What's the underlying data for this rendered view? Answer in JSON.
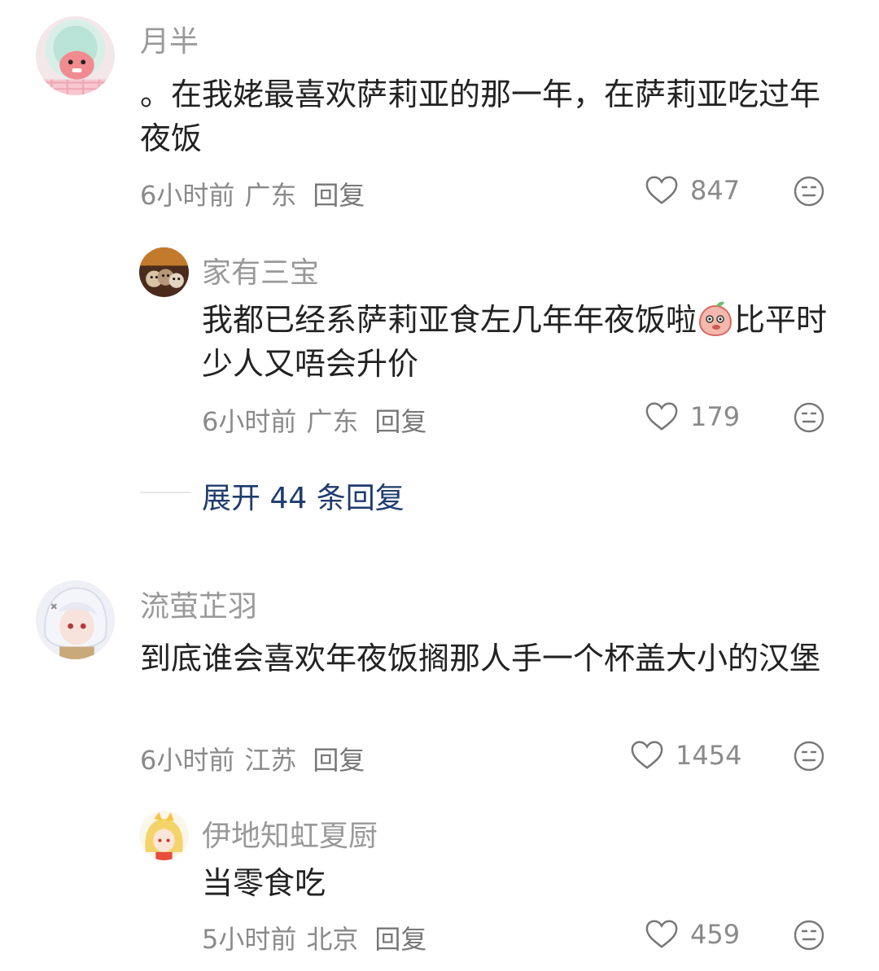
{
  "comments": [
    {
      "name": "月半",
      "text": "。在我姥最喜欢萨莉亚的那一年，在萨莉亚吃过年夜饭",
      "time": "6小时前",
      "location": "广东",
      "reply_label": "回复",
      "likes": "847",
      "avatar_icon": "plush-toy-avatar",
      "replies": [
        {
          "name": "家有三宝",
          "text_before": "我都已经系萨莉亚食左几年年夜饭啦",
          "emoji": "peach-emoji",
          "text_after": "比平时少人又唔会升价",
          "time": "6小时前",
          "location": "广东",
          "reply_label": "回复",
          "likes": "179",
          "avatar_icon": "cats-photo-avatar"
        }
      ],
      "expand_label": "展开 44 条回复"
    },
    {
      "name": "流萤芷羽",
      "text": "到底谁会喜欢年夜饭搁那人手一个杯盖大小的汉堡",
      "time": "6小时前",
      "location": "江苏",
      "reply_label": "回复",
      "likes": "1454",
      "avatar_icon": "anime-girl-avatar",
      "replies": [
        {
          "name": "伊地知虹夏厨",
          "text": "当零食吃",
          "time": "5小时前",
          "location": "北京",
          "reply_label": "回复",
          "likes": "459",
          "avatar_icon": "anime-blonde-avatar"
        }
      ]
    }
  ],
  "colors": {
    "name": "#999999",
    "text": "#222222",
    "meta": "#8a8a8a",
    "expand": "#1f3c6e"
  }
}
